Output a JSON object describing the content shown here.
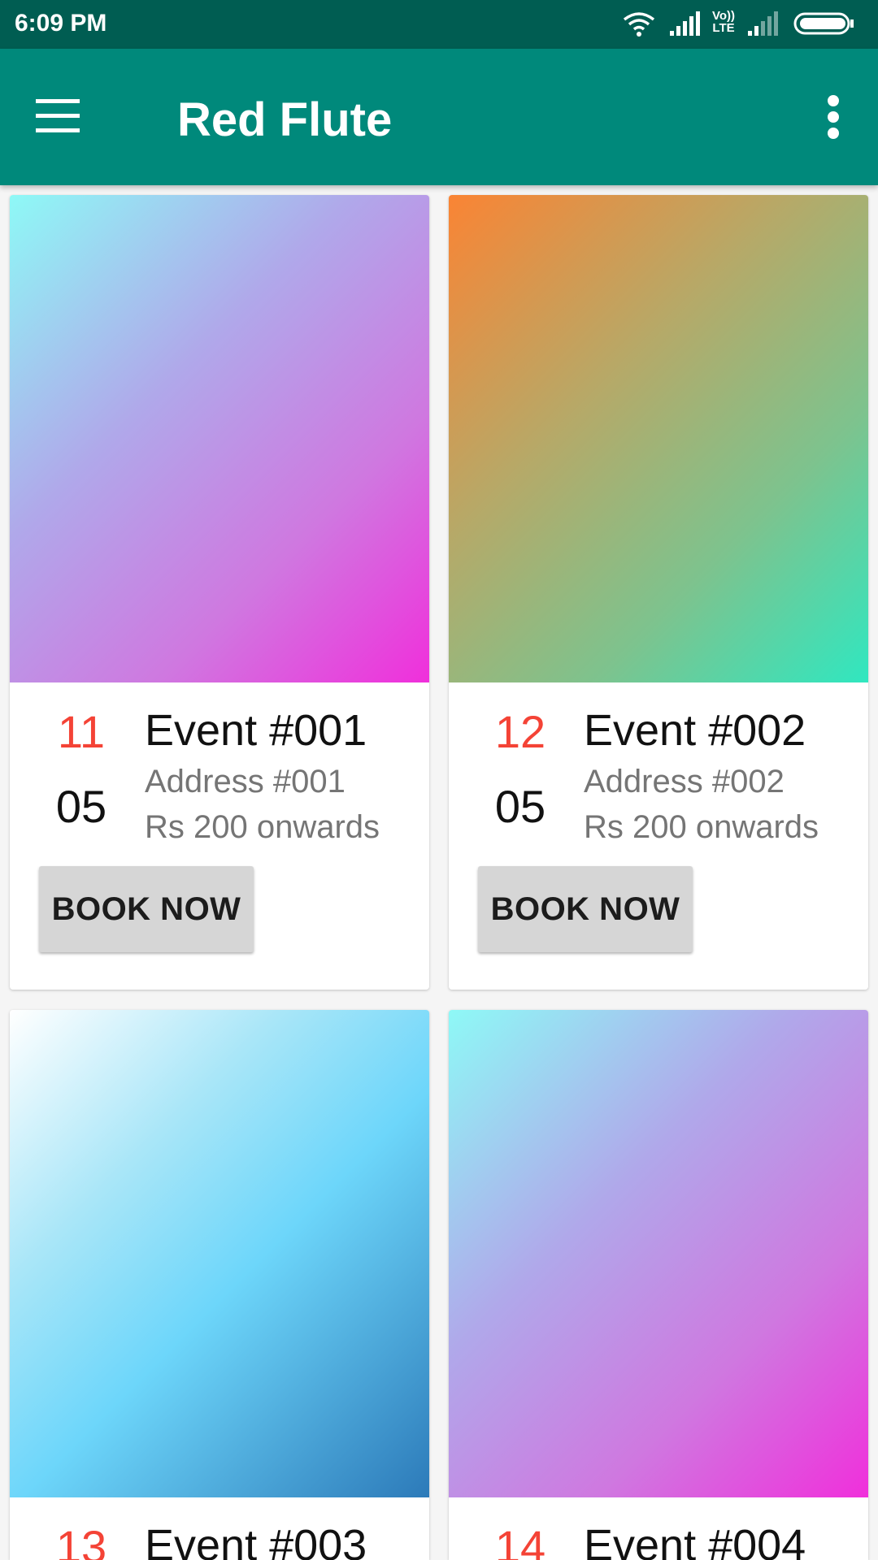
{
  "status_bar": {
    "time": "6:09 PM",
    "volte_label_top": "Vo))",
    "volte_label_bottom": "LTE",
    "icons": [
      "wifi-icon",
      "signal-icon",
      "volte-icon",
      "signal-weak-icon",
      "battery-icon"
    ]
  },
  "app_bar": {
    "title": "Red Flute",
    "background": "#00897b",
    "status_background": "#005d52",
    "icons": [
      "menu-icon",
      "more-vert-icon"
    ]
  },
  "events": [
    {
      "day": "11",
      "month": "05",
      "title": "Event #001",
      "address": "Address #001",
      "price": "Rs 200 onwards",
      "button": "BOOK NOW"
    },
    {
      "day": "12",
      "month": "05",
      "title": "Event #002",
      "address": "Address #002",
      "price": "Rs 200 onwards",
      "button": "BOOK NOW"
    },
    {
      "day": "13",
      "month": "",
      "title": "Event #003",
      "address": "",
      "price": "",
      "button": ""
    },
    {
      "day": "14",
      "month": "",
      "title": "Event #004",
      "address": "",
      "price": "",
      "button": ""
    }
  ],
  "colors": {
    "day_accent": "#f44336",
    "button_bg": "#d6d6d6"
  }
}
